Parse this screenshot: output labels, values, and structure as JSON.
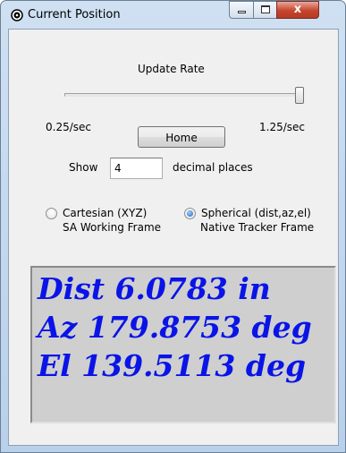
{
  "window": {
    "title": "Current Position",
    "close_glyph": "x"
  },
  "update_rate": {
    "label": "Update Rate",
    "min_label": "0.25/sec",
    "max_label": "1.25/sec",
    "slider_fraction": 1.0
  },
  "home_button": {
    "label": "Home"
  },
  "decimals": {
    "show_label": "Show",
    "value": "4",
    "suffix_label": "decimal places"
  },
  "coordinate_modes": [
    {
      "label": "Cartesian (XYZ)",
      "sublabel": "SA Working Frame",
      "selected": false
    },
    {
      "label": "Spherical (dist,az,el)",
      "sublabel": "Native Tracker Frame",
      "selected": true
    }
  ],
  "readout": {
    "color": "#0a14e6",
    "lines": [
      "Dist 6.0783 in",
      "Az 179.8753 deg",
      "El 139.5113 deg"
    ]
  },
  "icons": {
    "app": "target-icon",
    "minimize": "minimize-icon",
    "maximize": "maximize-icon",
    "close": "close-icon"
  }
}
